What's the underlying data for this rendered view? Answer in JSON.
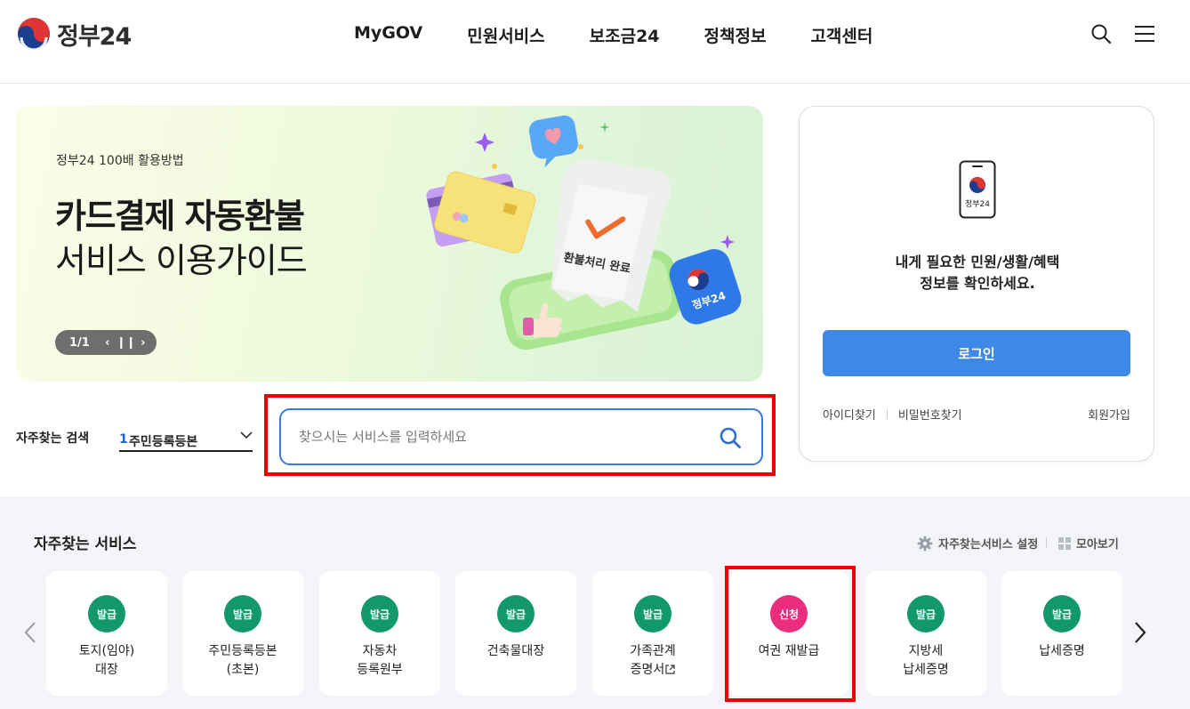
{
  "header": {
    "logo_text": "정부24",
    "nav": [
      "MyGOV",
      "민원서비스",
      "보조금24",
      "정책정보",
      "고객센터"
    ]
  },
  "banner": {
    "subtitle": "정부24 100배 활용방법",
    "title_bold": "카드결제 자동환불",
    "title_regular": "서비스 이용가이드",
    "page_indicator": "1/1",
    "art_receipt_text": "환불처리 완료",
    "art_badge_text": "정부24"
  },
  "login": {
    "phone_label": "정부24",
    "message_line1": "내게 필요한 민원/생활/혜택",
    "message_line2": "정보를 확인하세요.",
    "login_button": "로그인",
    "find_id": "아이디찾기",
    "find_pw": "비밀번호찾기",
    "join": "회원가입"
  },
  "search": {
    "label": "자주찾는 검색",
    "rank_number": "1",
    "rank_text": "주민등록등본",
    "placeholder": "찾으시는 서비스를 입력하세요",
    "value": ""
  },
  "services": {
    "title": "자주찾는 서비스",
    "setting_label": "자주찾는서비스 설정",
    "view_all_label": "모아보기",
    "cards": [
      {
        "badge": "발급",
        "type": "issue",
        "line1": "토지(임야)",
        "line2": "대장"
      },
      {
        "badge": "발급",
        "type": "issue",
        "line1": "주민등록등본",
        "line2": "(초본)"
      },
      {
        "badge": "발급",
        "type": "issue",
        "line1": "자동차",
        "line2": "등록원부"
      },
      {
        "badge": "발급",
        "type": "issue",
        "line1": "건축물대장",
        "line2": ""
      },
      {
        "badge": "발급",
        "type": "issue",
        "line1": "가족관계",
        "line2": "증명서"
      },
      {
        "badge": "신청",
        "type": "apply",
        "line1": "여권 재발급",
        "line2": ""
      },
      {
        "badge": "발급",
        "type": "issue",
        "line1": "지방세",
        "line2": "납세증명"
      },
      {
        "badge": "발급",
        "type": "issue",
        "line1": "납세증명",
        "line2": ""
      }
    ]
  },
  "colors": {
    "primary_blue": "#3e88e8",
    "issue_green": "#13986b",
    "apply_pink": "#ea2e7d",
    "highlight_red": "#ee0000"
  }
}
